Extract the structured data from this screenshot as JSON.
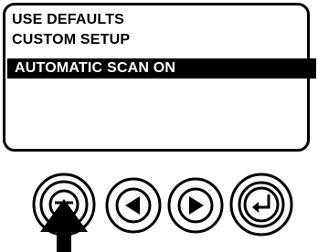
{
  "menu": {
    "items": [
      {
        "label": "USE DEFAULTS",
        "selected": false
      },
      {
        "label": "CUSTOM SETUP",
        "selected": false
      },
      {
        "label": "AUTOMATIC SCAN ON",
        "selected": true
      }
    ]
  },
  "buttons": [
    {
      "name": "menu-button",
      "icon": "menu-icon"
    },
    {
      "name": "left-button",
      "icon": "left-arrow-icon"
    },
    {
      "name": "right-button",
      "icon": "right-arrow-icon"
    },
    {
      "name": "enter-button",
      "icon": "enter-icon"
    }
  ],
  "colors": {
    "ink": "#000000",
    "background": "#ffffff",
    "highlight": "#000000"
  }
}
